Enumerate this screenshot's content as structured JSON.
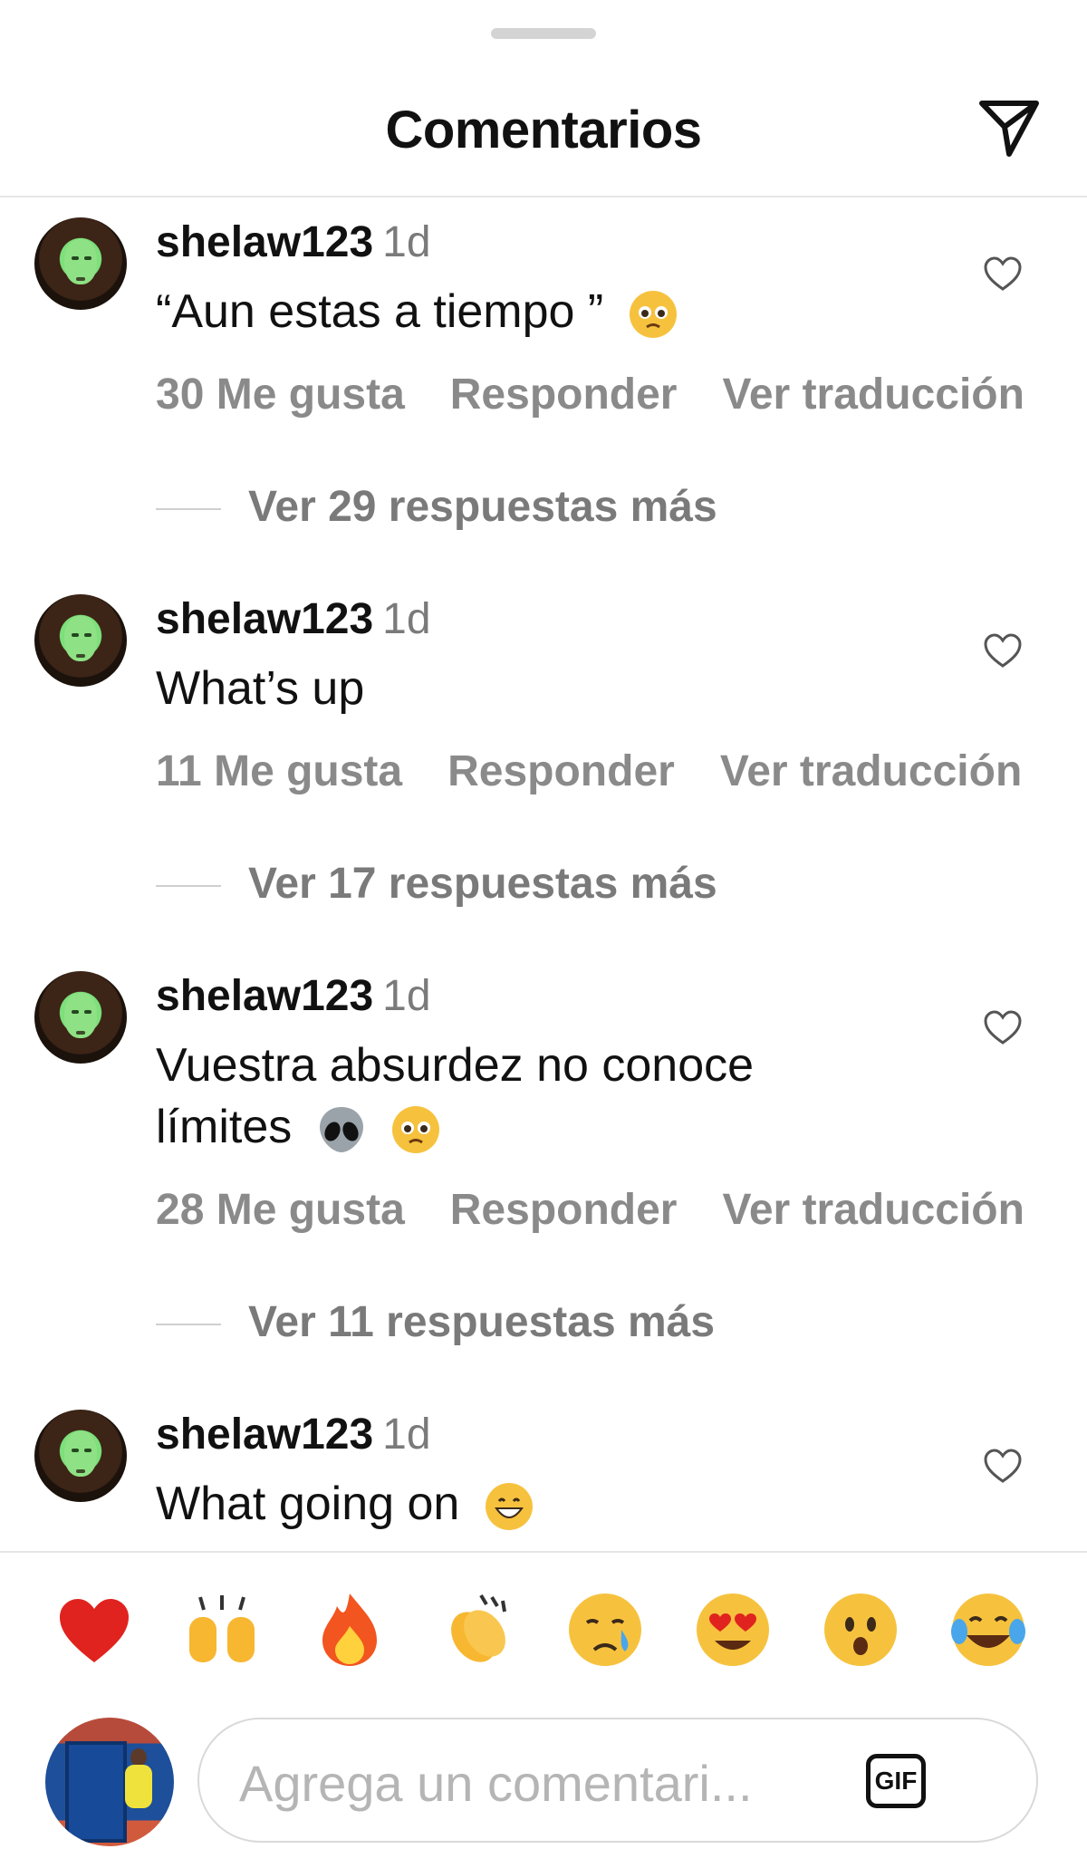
{
  "header": {
    "title": "Comentarios"
  },
  "comments": [
    {
      "username": "shelaw123",
      "time": "1d",
      "text": "“Aun estas a tiempo ”",
      "emojis": [
        "pleading-face"
      ],
      "likes": "30 Me gusta",
      "reply": "Responder",
      "translate": "Ver traducción",
      "more_replies": "Ver 29 respuestas más"
    },
    {
      "username": "shelaw123",
      "time": "1d",
      "text": "What’s up",
      "emojis": [],
      "likes": "11 Me gusta",
      "reply": "Responder",
      "translate": "Ver traducción",
      "more_replies": "Ver 17 respuestas más"
    },
    {
      "username": "shelaw123",
      "time": "1d",
      "text_line1": "Vuestra absurdez no conoce",
      "text_line2": "límites",
      "emojis": [
        "alien-face",
        "pleading-face"
      ],
      "likes": "28 Me gusta",
      "reply": "Responder",
      "translate": "Ver traducción",
      "more_replies": "Ver 11 respuestas más"
    },
    {
      "username": "shelaw123",
      "time": "1d",
      "text": "What going on",
      "emojis": [
        "grinning-face"
      ]
    }
  ],
  "reactions": [
    "red-heart",
    "raising-hands",
    "fire",
    "clapping-hands",
    "crying-face",
    "heart-eyes-face",
    "surprised-face",
    "tears-of-joy-face"
  ],
  "composer": {
    "placeholder": "Agrega un comentari...",
    "gif_label": "GIF"
  }
}
